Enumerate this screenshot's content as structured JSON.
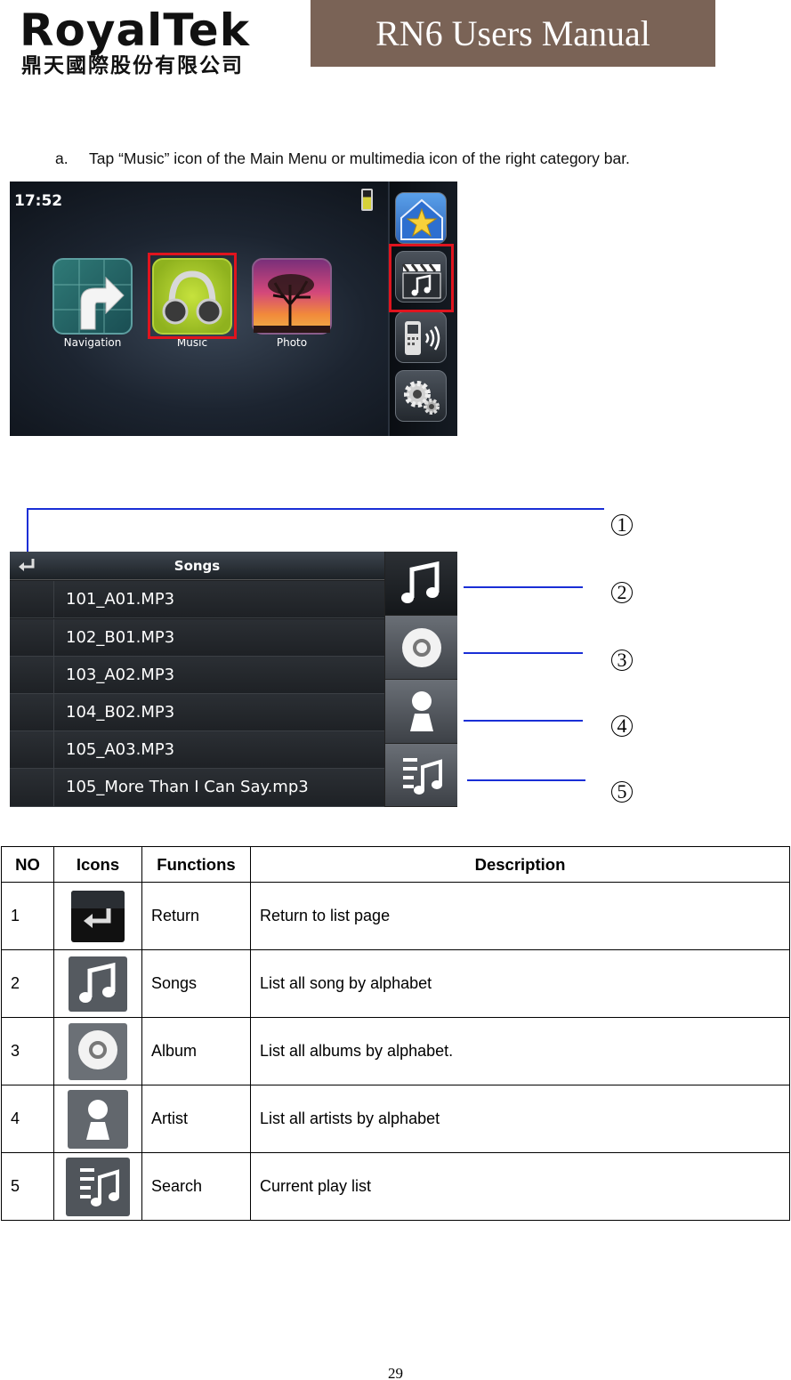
{
  "header": {
    "logo_name": "RoyalTek",
    "logo_subtitle": "鼎天國際股份有限公司",
    "manual_title": "RN6 Users Manual"
  },
  "instruction": {
    "letter": "a.",
    "text": "Tap “Music” icon of the Main Menu or multimedia icon of the right category bar."
  },
  "main_menu_screen": {
    "time": "17:52",
    "tiles": [
      {
        "label": "Navigation",
        "icon": "navigation-icon"
      },
      {
        "label": "Music",
        "icon": "headphones-icon"
      },
      {
        "label": "Photo",
        "icon": "tree-sunset-icon"
      }
    ],
    "sidebar_icons": [
      "favorites-star-icon",
      "multimedia-icon",
      "phone-icon",
      "settings-gear-icon"
    ],
    "highlight_color": "#e0141e"
  },
  "songs_screen": {
    "title": "Songs",
    "songs": [
      "101_A01.MP3",
      "102_B01.MP3",
      "103_A02.MP3",
      "104_B02.MP3",
      "105_A03.MP3",
      "105_More Than I Can Say.mp3"
    ],
    "side_tabs": [
      "music-note-icon",
      "album-disc-icon",
      "artist-person-icon",
      "playlist-icon"
    ]
  },
  "callouts": [
    "1",
    "2",
    "3",
    "4",
    "5"
  ],
  "callout_line_color": "#1a2fd6",
  "table": {
    "headers": [
      "NO",
      "Icons",
      "Functions",
      "Description"
    ],
    "rows": [
      {
        "no": "1",
        "icon": "return-icon",
        "function": "Return",
        "description": "Return to list page"
      },
      {
        "no": "2",
        "icon": "songs-icon",
        "function": "Songs",
        "description": "List all song by alphabet"
      },
      {
        "no": "3",
        "icon": "album-icon",
        "function": "Album",
        "description": "List all albums by alphabet."
      },
      {
        "no": "4",
        "icon": "artist-icon",
        "function": "Artist",
        "description": "List all artists by alphabet"
      },
      {
        "no": "5",
        "icon": "search-playlist-icon",
        "function": "Search",
        "description": "Current play list"
      }
    ]
  },
  "page_number": "29"
}
